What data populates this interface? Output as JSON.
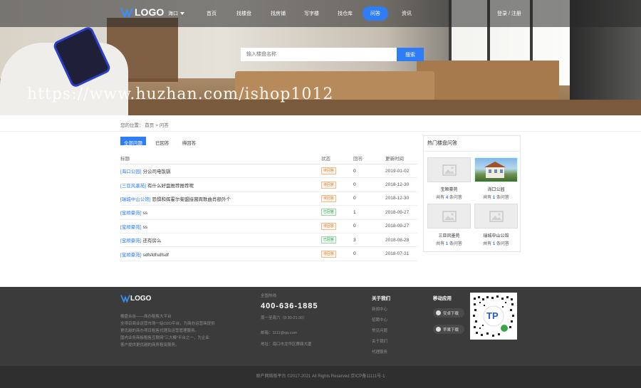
{
  "nav": {
    "logo_text": "LOGO",
    "city": "海口",
    "items": [
      "首页",
      "找楼盘",
      "找房铺",
      "写字楼",
      "找仓库",
      "问答",
      "资讯"
    ],
    "active": "问答",
    "login": "登录 / 注册"
  },
  "search": {
    "placeholder": "输入楼盘名称",
    "button": "搜索"
  },
  "watermark": "https://www.huzhan.com/ishop1012",
  "breadcrumb": "您的位置： 首页 > 问答",
  "tabs": [
    "全部问题",
    "已回答",
    "待回答"
  ],
  "table": {
    "headers": [
      "标题",
      "状态",
      "回答",
      "更新时间"
    ],
    "rows": [
      {
        "tag": "[海口公园]",
        "title": "分公司电饭锅",
        "status": "待回答",
        "status_type": "pending",
        "answers": "0",
        "date": "2019-01-02"
      },
      {
        "tag": "[三亚风墨苑]",
        "title": "有什么好盘推荐推荐呢",
        "status": "待回答",
        "status_type": "pending",
        "answers": "0",
        "date": "2018-12-30"
      },
      {
        "tag": "[瑞城中山公馆]",
        "title": "恐惧和挥霍尔菊盟接菌周歌曲肖额外个",
        "status": "待回答",
        "status_type": "pending",
        "answers": "0",
        "date": "2018-12-30"
      },
      {
        "tag": "[宝顺豪苑]",
        "title": "ss",
        "status": "已回答",
        "status_type": "done",
        "answers": "1",
        "date": "2018-09-27"
      },
      {
        "tag": "[宝顺豪苑]",
        "title": "ss",
        "status": "待回答",
        "status_type": "pending",
        "answers": "0",
        "date": "2018-09-27"
      },
      {
        "tag": "[宝顺豪苑]",
        "title": "还有房么",
        "status": "已回答",
        "status_type": "done",
        "answers": "3",
        "date": "2018-08-28"
      },
      {
        "tag": "[宝顺豪苑]",
        "title": "sdfsfdfsdfsdf",
        "status": "待回答",
        "status_type": "pending",
        "answers": "0",
        "date": "2018-07-31"
      }
    ]
  },
  "sidebar": {
    "title": "热门楼盘问答",
    "cards": [
      {
        "name": "宝顺豪苑",
        "prefix": "共有",
        "count": "4",
        "suffix": "条问答",
        "photo": false
      },
      {
        "name": "海口公园",
        "prefix": "共有",
        "count": "1",
        "suffix": "条问答",
        "photo": true
      },
      {
        "name": "三亚风墨苑",
        "prefix": "共有",
        "count": "1",
        "suffix": "条问答",
        "photo": false
      },
      {
        "name": "瑞城中山公馆",
        "prefix": "共有",
        "count": "1",
        "suffix": "条问答",
        "photo": false
      }
    ]
  },
  "footer": {
    "logo_text": "LOGO",
    "desc": [
      "楼盘合谷——商办租售大平台",
      "全项目商业运营市场一站O2O平台，为商办运营商提供",
      "更优越的商办项目租售代理及运营管理服务。",
      "国内业务商板租售互联网\"三大模\"平台之一，为企业",
      "客户提供更优越的商务租赁服务。"
    ],
    "hotline_label": "全国热线",
    "hotline": "400-636-1885",
    "hours": "周一至周六（8:30-21:30）",
    "email": "邮箱：1111@qq.com",
    "address": "地址：海口市龙华区赛鼎大厦",
    "about_title": "关于我们",
    "about_links": [
      "新闻中心",
      "招聘中心",
      "常见问题",
      "关于我们",
      "代理服务"
    ],
    "mobile_title": "移动应用",
    "android": "安卓下载",
    "ios": "苹果下载",
    "qr_text": "TP",
    "copyright": "原产网络版平台 ©2017-2021 All Rights Reserved 京ICP备11111号-1"
  },
  "colors": {
    "accent": "#2e7cf6",
    "footer_bg": "#3b3b3b",
    "pending": "#e87a2c",
    "done": "#2aa54a"
  }
}
